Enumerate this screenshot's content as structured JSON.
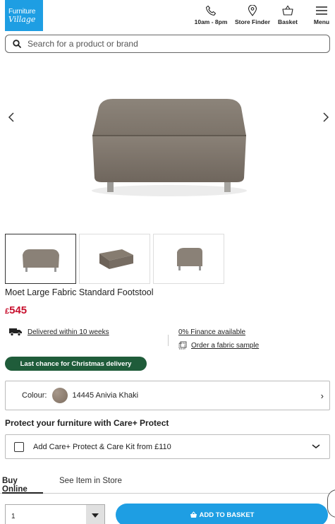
{
  "header": {
    "logo_line1": "Furniture",
    "logo_line2": "Village",
    "nav": [
      {
        "label": "10am - 8pm",
        "icon": "phone-icon"
      },
      {
        "label": "Store Finder",
        "icon": "location-pin-icon"
      },
      {
        "label": "Basket",
        "icon": "basket-icon"
      },
      {
        "label": "Menu",
        "icon": "hamburger-menu-icon"
      }
    ]
  },
  "search": {
    "placeholder": "Search for a product or brand"
  },
  "product": {
    "title": "Moet Large Fabric Standard Footstool",
    "currency": "£",
    "price": "545",
    "delivery_text": "Delivered within 10 weeks",
    "finance_text": "0% Finance available",
    "sample_text": "Order a fabric sample",
    "badge": "Last chance for Christmas delivery",
    "colour_label": "Colour:",
    "colour_value": "14445 Anivia Khaki",
    "colour_swatch": "#8c7c6c",
    "protect_title": "Protect your furniture with Care+ Protect",
    "care_option": "Add Care+ Protect & Care Kit from £110"
  },
  "tabs": [
    "Buy Online",
    "See Item in Store"
  ],
  "purchase": {
    "quantity": "1",
    "add_button": "ADD TO BASKET"
  },
  "colors": {
    "brand_blue": "#1e9ee3",
    "price_red": "#c8102e",
    "badge_green": "#1f5c3a"
  }
}
